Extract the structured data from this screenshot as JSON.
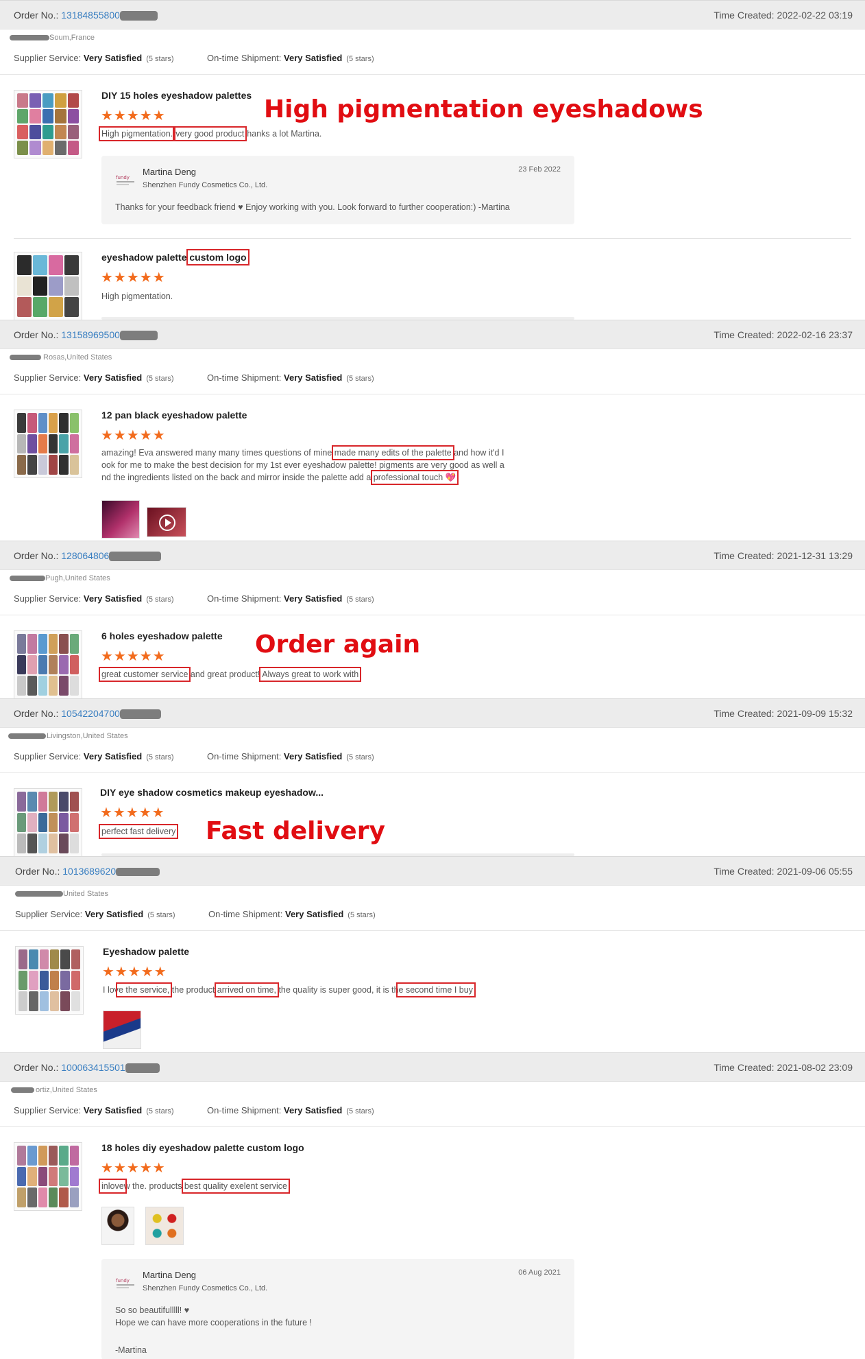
{
  "labels": {
    "order_no": "Order No.:",
    "time_created": "Time Created:",
    "supplier_service": "Supplier Service:",
    "ontime_shipment": "On-time Shipment:",
    "very_satisfied": "Very Satisfied",
    "five_stars": "(5 stars)",
    "stars_glyph": "★★★★★"
  },
  "orders": [
    {
      "order_no": "13184855800",
      "time": "2022-02-22 03:19",
      "buyer_location": "Soum,France",
      "items": [
        {
          "title": "DIY 15 holes eyeshadow palettes",
          "review": {
            "p1": "High pigmentation.",
            "p2": "very good product",
            "p3": "hanks a lot Martina."
          },
          "reply": {
            "name": "Martina Deng",
            "company": "Shenzhen Fundy Cosmetics Co., Ltd.",
            "date": "23 Feb 2022",
            "text": "Thanks for your feedback friend ♥ Enjoy working with you. Look forward to further cooperation:) -Martina"
          }
        },
        {
          "title_p1": "eyeshadow palette",
          "title_p2": "custom logo",
          "review": "High pigmentation."
        }
      ]
    },
    {
      "order_no": "13158969500",
      "time": "2022-02-16 23:37",
      "buyer_location": "Rosas,United States",
      "items": [
        {
          "title": "12 pan black eyeshadow palette",
          "review": {
            "l1a": "amazing! Eva answered many many times questions of mine",
            "l1b": "made many edits of the palette",
            "l1c": "and how it'd I",
            "l2": "ook for me to make the best decision for my 1st ever eyeshadow palette! pigments are very good as well a",
            "l3a": "nd the ingredients listed on the back  and mirror inside the palette add a",
            "l3b": "professional touch 💖"
          }
        }
      ]
    },
    {
      "order_no": "128064806",
      "time": "2021-12-31 13:29",
      "buyer_location": "Pugh,United States",
      "items": [
        {
          "title": "6 holes eyeshadow palette",
          "review": {
            "p1": "great customer service",
            "p2": "and great product!",
            "p3": "Always great to work with"
          }
        }
      ]
    },
    {
      "order_no": "10542204700",
      "time": "2021-09-09 15:32",
      "buyer_location": "Livingston,United States",
      "items": [
        {
          "title": "DIY eye shadow cosmetics makeup eyeshadow...",
          "review": "perfect fast delivery"
        }
      ]
    },
    {
      "order_no": "1013689620",
      "time": "2021-09-06 05:55",
      "buyer_location": "United States",
      "items": [
        {
          "title": "Eyeshadow palette",
          "review": {
            "p1": "I lov",
            "p2": "e the service,",
            "p3": "the product",
            "p4": "arrived on time,",
            "p5": "the quality is super good, it is th",
            "p6": "e second time I buy"
          }
        }
      ]
    },
    {
      "order_no": "100063415501",
      "time": "2021-08-02 23:09",
      "buyer_location": "ortiz,United States",
      "items": [
        {
          "title": "18 holes diy eyeshadow palette custom logo",
          "review": {
            "p1": "inlove",
            "p2": "w the. products",
            "p3": "best quality exelent service"
          },
          "reply": {
            "name": "Martina Deng",
            "company": "Shenzhen Fundy Cosmetics Co., Ltd.",
            "date": "06 Aug 2021",
            "line1": "So so beautifulllll!  ♥",
            "line2": "Hope we can have more cooperations in the future !",
            "line3": "-Martina"
          }
        }
      ]
    }
  ],
  "annotations": {
    "a1": "High pigmentation eyeshadows",
    "a2": "Order again",
    "a3": "Fast delivery"
  }
}
